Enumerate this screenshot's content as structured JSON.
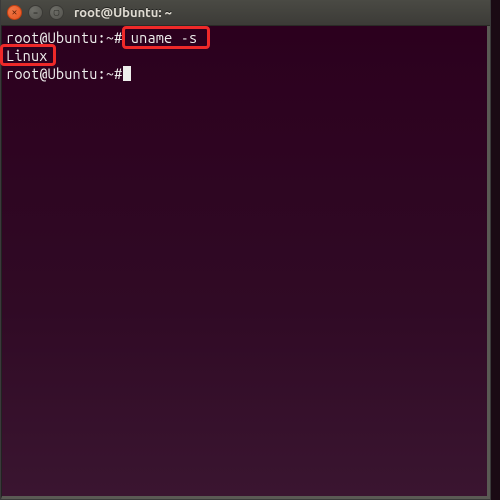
{
  "window": {
    "title": "root@Ubuntu: ~"
  },
  "terminal": {
    "lines": [
      {
        "prompt": "root@Ubuntu:~#",
        "command": " uname -s"
      },
      {
        "output": "Linux"
      },
      {
        "prompt": "root@Ubuntu:~#",
        "command": ""
      }
    ]
  },
  "annotations": {
    "highlight_command": "uname -s",
    "highlight_output": "Linux"
  },
  "icons": {
    "close": "✕",
    "minimize": "–",
    "maximize": "▢"
  }
}
